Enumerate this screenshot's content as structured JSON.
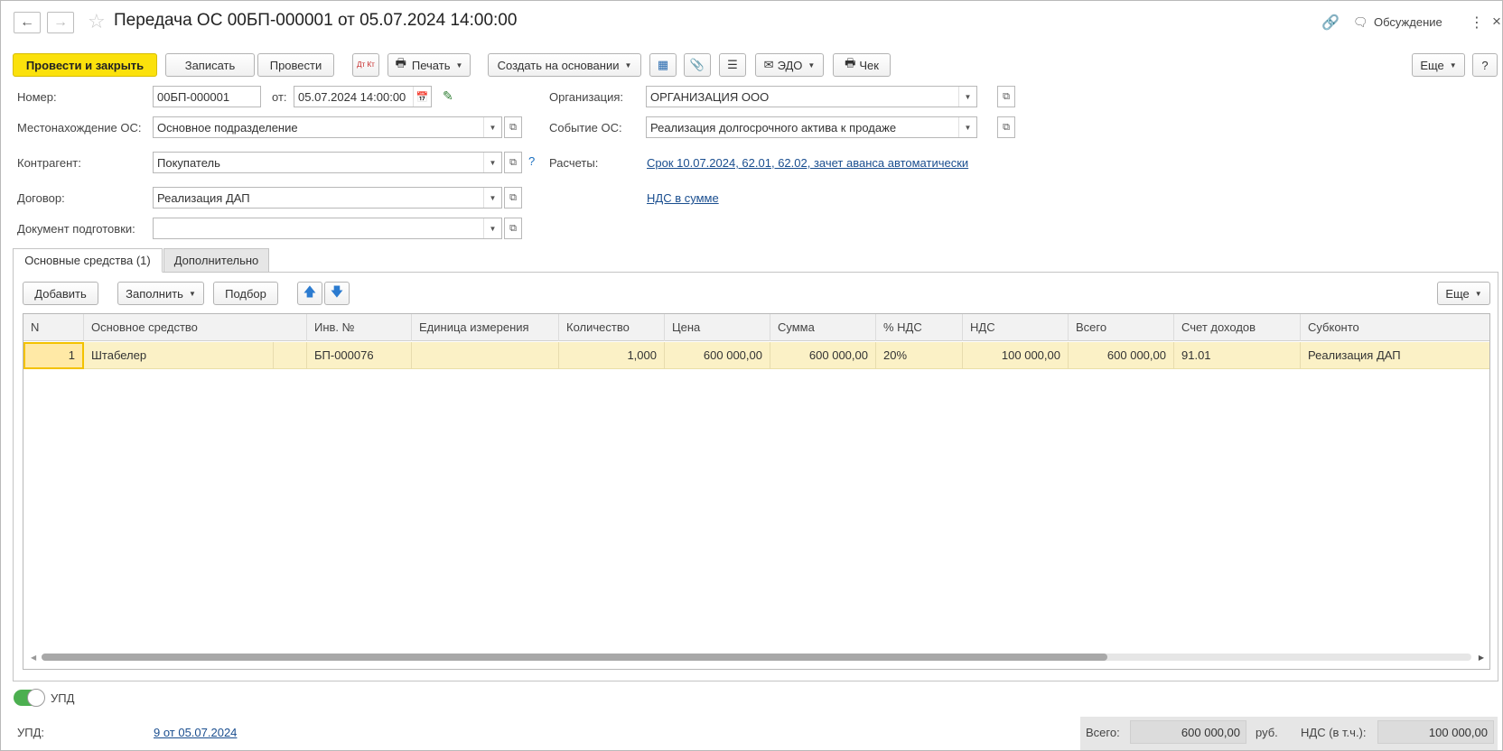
{
  "window": {
    "title": "Передача ОС 00БП-000001 от 05.07.2024 14:00:00",
    "discussion_label": "Обсуждение"
  },
  "toolbar": {
    "post_close": "Провести и закрыть",
    "save": "Записать",
    "post": "Провести",
    "dt_kt_icon": "Дт Кт",
    "print": "Печать",
    "create_based": "Создать на основании",
    "edo": "ЭДО",
    "receipt": "Чек",
    "more": "Еще",
    "help": "?"
  },
  "form": {
    "number_label": "Номер:",
    "number_value": "00БП-000001",
    "date_label": "от:",
    "date_value": "05.07.2024 14:00:00",
    "location_label": "Местонахождение ОС:",
    "location_value": "Основное подразделение",
    "counterparty_label": "Контрагент:",
    "counterparty_value": "Покупатель",
    "contract_label": "Договор:",
    "contract_value": "Реализация ДАП",
    "prep_doc_label": "Документ подготовки:",
    "prep_doc_value": "",
    "org_label": "Организация:",
    "org_value": "ОРГАНИЗАЦИЯ ООО",
    "event_label": "Событие ОС:",
    "event_value": "Реализация долгосрочного актива к продаже",
    "settlements_label": "Расчеты:",
    "settlements_link": "Срок 10.07.2024, 62.01, 62.02, зачет аванса автоматически",
    "vat_link": "НДС в сумме",
    "help_mark": "?"
  },
  "tabs": [
    {
      "label": "Основные средства (1)",
      "active": true
    },
    {
      "label": "Дополнительно",
      "active": false
    }
  ],
  "table_toolbar": {
    "add": "Добавить",
    "fill": "Заполнить",
    "pick": "Подбор",
    "more": "Еще"
  },
  "table": {
    "columns": [
      "N",
      "Основное средство",
      "Инв. №",
      "Единица измерения",
      "Количество",
      "Цена",
      "Сумма",
      "% НДС",
      "НДС",
      "Всего",
      "Счет доходов",
      "Субконто"
    ],
    "rows": [
      [
        "1",
        "Штабелер",
        "БП-000076",
        "",
        "1,000",
        "600 000,00",
        "600 000,00",
        "20%",
        "100 000,00",
        "600 000,00",
        "91.01",
        "Реализация ДАП"
      ]
    ]
  },
  "bottom": {
    "upd_toggle_label": "УПД",
    "upd_label": "УПД:",
    "upd_link": "9 от 05.07.2024",
    "total_label": "Всего:",
    "total_value": "600 000,00",
    "currency": "руб.",
    "vat_incl_label": "НДС (в т.ч.):",
    "vat_incl_value": "100 000,00"
  },
  "colors": {
    "primary_button": "#fbe10c",
    "selected_row": "#fbf1c6",
    "link": "#1a4e8f",
    "toggle_on": "#4caf50"
  }
}
